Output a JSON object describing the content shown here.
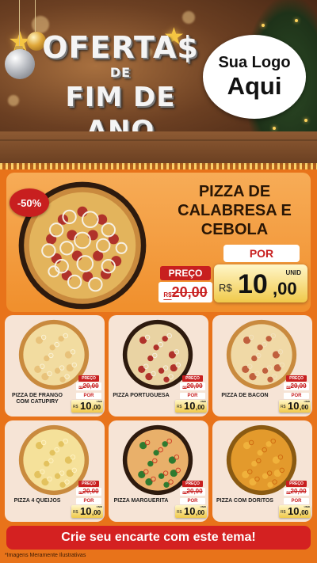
{
  "header": {
    "headline": {
      "line1": "OFERTA$",
      "line2": "DE",
      "line3": "FIM DE ANO"
    },
    "logo": {
      "line1": "Sua Logo",
      "line2": "Aqui"
    }
  },
  "featured": {
    "discount": "-50%",
    "title": "PIZZA DE CALABRESA E CEBOLA",
    "preco_label": "PREÇO",
    "por_label": "POR",
    "old_price": {
      "currency": "R$",
      "value": "20,00"
    },
    "new_price": {
      "currency": "R$",
      "integer": "10",
      "cents": ",00",
      "unit": "UNID"
    }
  },
  "products": [
    {
      "name": "PIZZA DE FRANGO COM CATUPIRY",
      "topping": "chicken"
    },
    {
      "name": "PIZZA PORTUGUESA",
      "topping": "portuguesa"
    },
    {
      "name": "PIZZA DE BACON",
      "topping": "bacon"
    },
    {
      "name": "PIZZA 4 QUEIJOS",
      "topping": "cheese"
    },
    {
      "name": "PIZZA MARGUERITA",
      "topping": "margherita"
    },
    {
      "name": "PIZZA COM DORITOS",
      "topping": "doritos"
    }
  ],
  "product_pricing": {
    "preco_label": "PREÇO",
    "por_label": "POR",
    "old_currency": "R$",
    "old_value": "20,00",
    "new_currency": "R$",
    "new_integer": "10",
    "new_cents": ",00",
    "unit": "UNID"
  },
  "cta": "Crie seu encarte com este tema!",
  "disclaimer": "*Imagens Meramente Ilustrativas",
  "colors": {
    "background": "#e8731a",
    "accent_red": "#d42121",
    "card_bg": "#f6e4d6",
    "price_gold": "#f0c94a"
  }
}
